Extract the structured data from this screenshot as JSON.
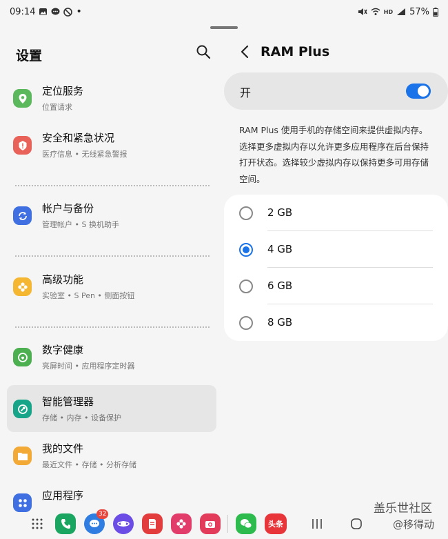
{
  "status": {
    "time": "09:14",
    "battery": "57%",
    "icons_left": [
      "image-icon",
      "chat-icon",
      "dnd-icon",
      "dot"
    ],
    "icons_right": [
      "mute-icon",
      "wifi-icon",
      "hd-icon",
      "signal-icon",
      "battery-icon"
    ],
    "network_label": "HD"
  },
  "left": {
    "title": "设置",
    "items": [
      {
        "title": "定位服务",
        "subtitle": "位置请求",
        "icon": "location-icon",
        "color": "#5cb85c"
      },
      {
        "title": "安全和紧急状况",
        "subtitle": "医疗信息 • 无线紧急警报",
        "icon": "alert-icon",
        "color": "#e8625a"
      },
      {
        "title": "帐户与备份",
        "subtitle": "管理帐户 • S 换机助手",
        "icon": "sync-icon",
        "color": "#3f6fe0"
      },
      {
        "title": "高级功能",
        "subtitle": "实验室 • S Pen • 侧面按钮",
        "icon": "gear-flower-icon",
        "color": "#f5b731"
      },
      {
        "title": "数字健康",
        "subtitle": "亮屏时间 • 应用程序定时器",
        "icon": "wellbeing-icon",
        "color": "#4caf50"
      },
      {
        "title": "智能管理器",
        "subtitle": "存储 • 内存 • 设备保护",
        "icon": "device-care-icon",
        "color": "#17a589"
      },
      {
        "title": "我的文件",
        "subtitle": "最近文件 • 存储 • 分析存储",
        "icon": "folder-icon",
        "color": "#f2a935"
      },
      {
        "title": "应用程序",
        "subtitle": "",
        "icon": "apps-icon",
        "color": "#3f6fe0"
      }
    ]
  },
  "right": {
    "title": "RAM Plus",
    "toggle_label": "开",
    "toggle_on": true,
    "description": "RAM Plus 使用手机的存储空间来提供虚拟内存。选择更多虚拟内存以允许更多应用程序在后台保持打开状态。选择较少虚拟内存以保持更多可用存储空间。",
    "options": [
      "2 GB",
      "4 GB",
      "6 GB",
      "8 GB"
    ],
    "selected": "4 GB"
  },
  "nav": {
    "apps": [
      {
        "name": "apps-grid-icon",
        "color": "transparent"
      },
      {
        "name": "phone-icon",
        "color": "#1aa560"
      },
      {
        "name": "messages-icon",
        "color": "#2f7de1",
        "badge": "32"
      },
      {
        "name": "internet-icon",
        "color": "#6b4de6"
      },
      {
        "name": "notes-icon",
        "color": "#e23c3c"
      },
      {
        "name": "bixby-flower-icon",
        "color": "#e23c6b"
      },
      {
        "name": "camera-icon",
        "color": "#e23c5a"
      },
      {
        "name": "wechat-icon",
        "color": "#2dbb4d"
      },
      {
        "name": "toutiao-icon",
        "color": "#e8353a",
        "label": "头条"
      }
    ]
  },
  "watermark": {
    "line1": "盖乐世社区",
    "line2": "@移得动"
  }
}
